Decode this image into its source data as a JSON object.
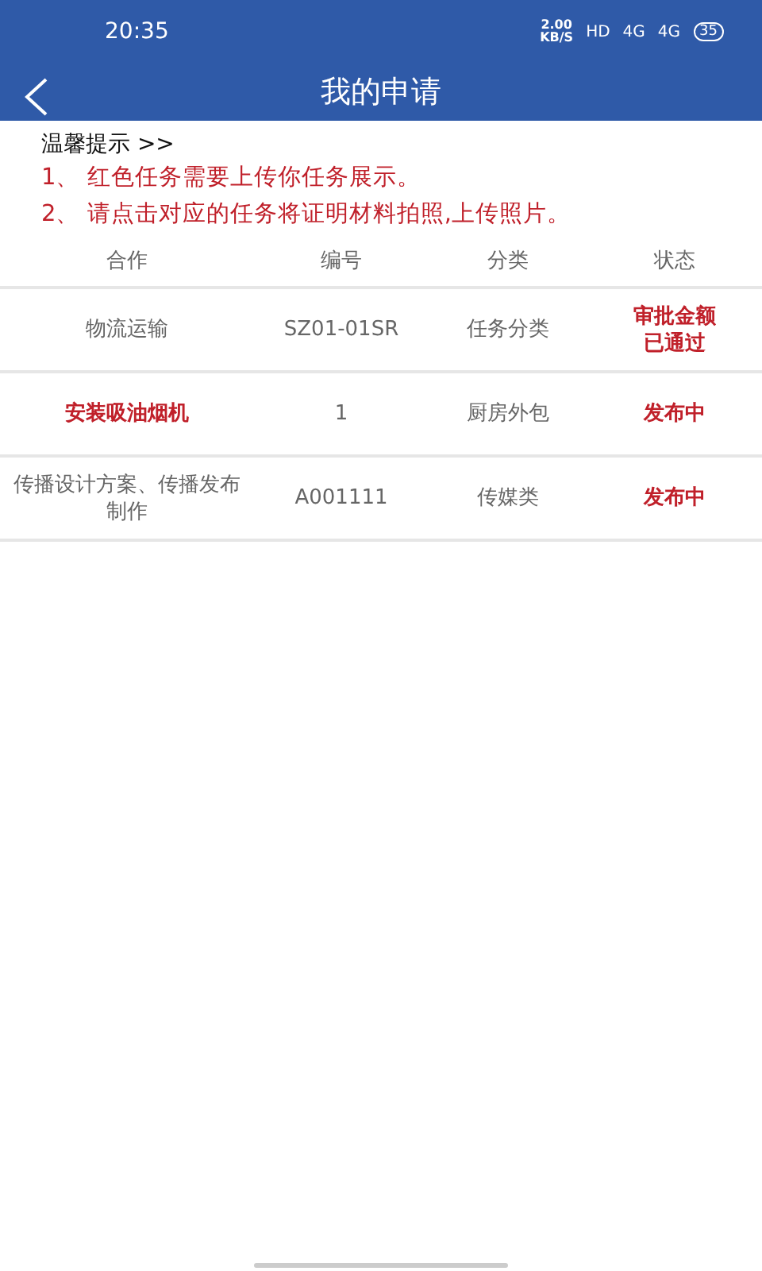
{
  "status_bar": {
    "time": "20:35",
    "speed": "2.00",
    "speed_unit": "KB/S",
    "hd": "HD",
    "network_1": "4G",
    "network_2": "4G",
    "battery": "35"
  },
  "header": {
    "title": "我的申请"
  },
  "tips": {
    "title": "温馨提示 >>",
    "lines": [
      "1、 红色任务需要上传你任务展示。",
      "2、 请点击对应的任务将证明材料拍照,上传照片。"
    ]
  },
  "table": {
    "columns": [
      "合作",
      "编号",
      "分类",
      "状态"
    ],
    "rows": [
      {
        "name": "物流运输",
        "name_red": false,
        "number": "SZ01-01SR",
        "category": "任务分类",
        "status": "审批金额已通过"
      },
      {
        "name": "安装吸油烟机",
        "name_red": true,
        "number": "1",
        "category": "厨房外包",
        "status": "发布中"
      },
      {
        "name": "传播设计方案、传播发布制作",
        "name_red": false,
        "number": "A001111",
        "category": "传媒类",
        "status": "发布中"
      }
    ]
  }
}
